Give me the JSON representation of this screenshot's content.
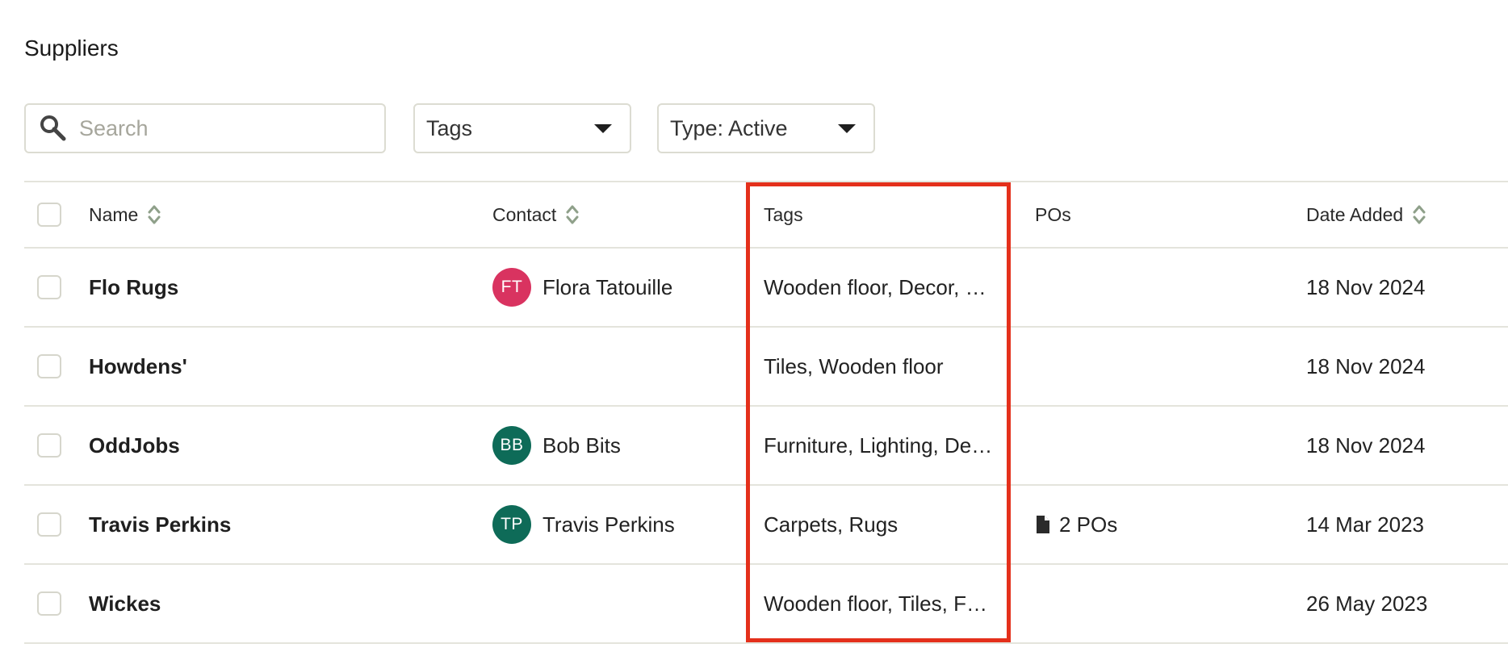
{
  "page": {
    "title": "Suppliers"
  },
  "filters": {
    "search_placeholder": "Search",
    "tags_label": "Tags",
    "type_label": "Type: Active"
  },
  "table": {
    "headers": {
      "name": "Name",
      "contact": "Contact",
      "tags": "Tags",
      "pos": "POs",
      "date_added": "Date Added"
    },
    "rows": [
      {
        "name": "Flo Rugs",
        "contact_initials": "FT",
        "contact_name": "Flora Tatouille",
        "contact_color": "#d93360",
        "tags": "Wooden floor, Decor, Rugs",
        "pos": "",
        "date": "18 Nov 2024"
      },
      {
        "name": "Howdens'",
        "contact_initials": "",
        "contact_name": "",
        "contact_color": "",
        "tags": "Tiles, Wooden floor",
        "pos": "",
        "date": "18 Nov 2024"
      },
      {
        "name": "OddJobs",
        "contact_initials": "BB",
        "contact_name": "Bob Bits",
        "contact_color": "#0e6b58",
        "tags": "Furniture, Lighting, Decor",
        "pos": "",
        "date": "18 Nov 2024"
      },
      {
        "name": "Travis Perkins",
        "contact_initials": "TP",
        "contact_name": "Travis Perkins",
        "contact_color": "#0e6b58",
        "tags": "Carpets, Rugs",
        "pos": "2 POs",
        "date": "14 Mar 2023"
      },
      {
        "name": "Wickes",
        "contact_initials": "",
        "contact_name": "",
        "contact_color": "",
        "tags": "Wooden floor, Tiles, Furniture",
        "pos": "",
        "date": "26 May 2023"
      }
    ]
  },
  "colors": {
    "highlight": "#e4301b",
    "accent_sort": "#8fa08a"
  }
}
